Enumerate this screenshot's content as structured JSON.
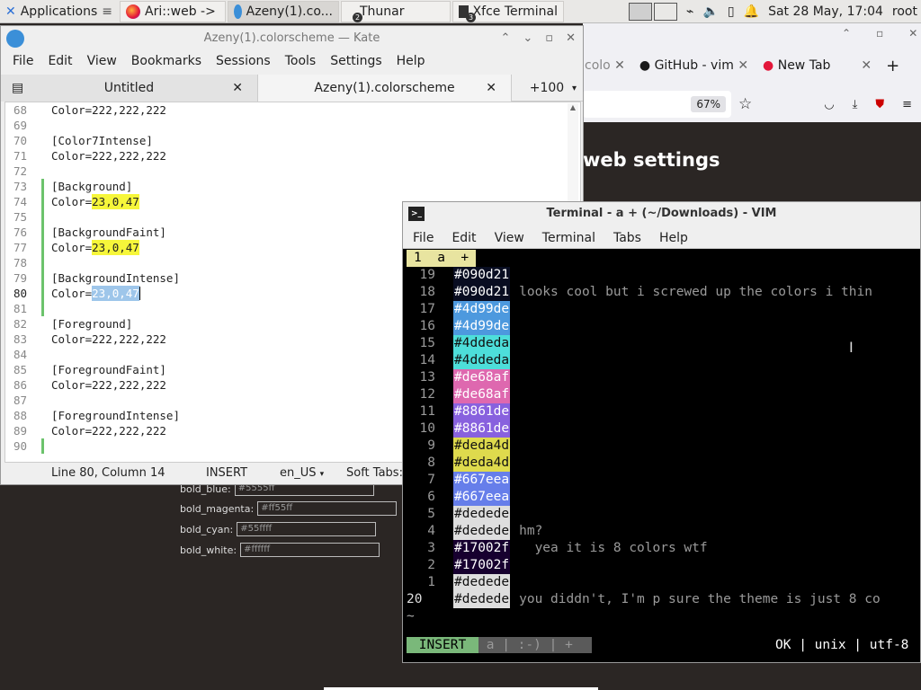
{
  "panel": {
    "apps_label": "Applications",
    "tasks": [
      {
        "label": "Ari::web ->"
      },
      {
        "label": "Azeny(1).co..."
      },
      {
        "label": "Thunar",
        "badge": "2"
      },
      {
        "label": "Xfce Terminal",
        "badge": "3"
      }
    ],
    "clock": "Sat 28 May, 17:04",
    "user": "root"
  },
  "firefox": {
    "tabs": [
      "colo",
      "GitHub - vim",
      "New Tab"
    ],
    "zoom": "67%",
    "heading": "web settings"
  },
  "web_form": [
    {
      "label": "bold_blue:",
      "value": "#5555ff"
    },
    {
      "label": "bold_magenta:",
      "value": "#ff55ff"
    },
    {
      "label": "bold_cyan:",
      "value": "#55ffff"
    },
    {
      "label": "bold_white:",
      "value": "#ffffff"
    }
  ],
  "kate": {
    "title": "Azeny(1).colorscheme  — Kate",
    "menu": [
      "File",
      "Edit",
      "View",
      "Bookmarks",
      "Sessions",
      "Tools",
      "Settings",
      "Help"
    ],
    "tabs": [
      "Untitled",
      "Azeny(1).colorscheme",
      "+100"
    ],
    "lines": [
      {
        "n": "68",
        "pre": "Color=222,222,222"
      },
      {
        "n": "69",
        "pre": ""
      },
      {
        "n": "70",
        "pre": "[Color7Intense]"
      },
      {
        "n": "71",
        "pre": "Color=222,222,222"
      },
      {
        "n": "72",
        "pre": ""
      },
      {
        "n": "73",
        "pre": "[Background]",
        "mod": true
      },
      {
        "n": "74",
        "pre": "Color=",
        "hl": "23,0,47",
        "mod": true
      },
      {
        "n": "75",
        "pre": "",
        "mod": true
      },
      {
        "n": "76",
        "pre": "[BackgroundFaint]",
        "mod": true
      },
      {
        "n": "77",
        "pre": "Color=",
        "hl": "23,0,47",
        "mod": true
      },
      {
        "n": "78",
        "pre": "",
        "mod": true
      },
      {
        "n": "79",
        "pre": "[BackgroundIntense]",
        "mod": true
      },
      {
        "n": "80",
        "pre": "Color=",
        "sel": "23,0,47",
        "mod": true,
        "cur": true
      },
      {
        "n": "81",
        "pre": "",
        "mod": true
      },
      {
        "n": "82",
        "pre": "[Foreground]"
      },
      {
        "n": "83",
        "pre": "Color=222,222,222"
      },
      {
        "n": "84",
        "pre": ""
      },
      {
        "n": "85",
        "pre": "[ForegroundFaint]"
      },
      {
        "n": "86",
        "pre": "Color=222,222,222"
      },
      {
        "n": "87",
        "pre": ""
      },
      {
        "n": "88",
        "pre": "[ForegroundIntense]"
      },
      {
        "n": "89",
        "pre": "Color=222,222,222"
      },
      {
        "n": "90",
        "pre": "",
        "mod": true
      }
    ],
    "status": {
      "position": "Line 80, Column 14",
      "mode": "INSERT",
      "lang": "en_US",
      "tabs": "Soft Tabs:"
    }
  },
  "terminal": {
    "title": "Terminal - a + (~/Downloads) - VIM",
    "menu": [
      "File",
      "Edit",
      "View",
      "Terminal",
      "Tabs",
      "Help"
    ],
    "tabline": "1  a  +",
    "rows": [
      {
        "n": "19",
        "code": "#090d21",
        "bg": "#090d21",
        "text": ""
      },
      {
        "n": "18",
        "code": "#090d21",
        "bg": "#090d21",
        "text": "looks cool but i screwed up the colors i thin"
      },
      {
        "n": "17",
        "code": "#4d99de",
        "bg": "#4d99de",
        "text": ""
      },
      {
        "n": "16",
        "code": "#4d99de",
        "bg": "#4d99de",
        "text": ""
      },
      {
        "n": "15",
        "code": "#4ddeda",
        "bg": "#4ddeda",
        "text": ""
      },
      {
        "n": "14",
        "code": "#4ddeda",
        "bg": "#4ddeda",
        "text": ""
      },
      {
        "n": "13",
        "code": "#de68af",
        "bg": "#de68af",
        "text": ""
      },
      {
        "n": "12",
        "code": "#de68af",
        "bg": "#de68af",
        "text": ""
      },
      {
        "n": "11",
        "code": "#8861de",
        "bg": "#8861de",
        "text": ""
      },
      {
        "n": "10",
        "code": "#8861de",
        "bg": "#8861de",
        "text": ""
      },
      {
        "n": "9",
        "code": "#deda4d",
        "bg": "#deda4d",
        "text": ""
      },
      {
        "n": "8",
        "code": "#deda4d",
        "bg": "#deda4d",
        "text": ""
      },
      {
        "n": "7",
        "code": "#667eea",
        "bg": "#667eea",
        "text": ""
      },
      {
        "n": "6",
        "code": "#667eea",
        "bg": "#667eea",
        "text": ""
      },
      {
        "n": "5",
        "code": "#dedede",
        "bg": "#dedede",
        "text": ""
      },
      {
        "n": "4",
        "code": "#dedede",
        "bg": "#dedede",
        "text": "hm?"
      },
      {
        "n": "3",
        "code": "#17002f",
        "bg": "#17002f",
        "text": "  yea it is 8 colors wtf"
      },
      {
        "n": "2",
        "code": "#17002f",
        "bg": "#17002f",
        "text": ""
      },
      {
        "n": "1",
        "code": "#dedede",
        "bg": "#dedede",
        "text": ""
      },
      {
        "n": "20",
        "code": "#dedede",
        "bg": "#dedede",
        "text": "you diddn't, I'm p sure the theme is just 8 co"
      }
    ],
    "tilde": "~",
    "statusline": {
      "mode": "INSERT",
      "file": "a",
      "flags": ":-)",
      "plus": "+",
      "right": "OK | unix | utf-8"
    }
  }
}
